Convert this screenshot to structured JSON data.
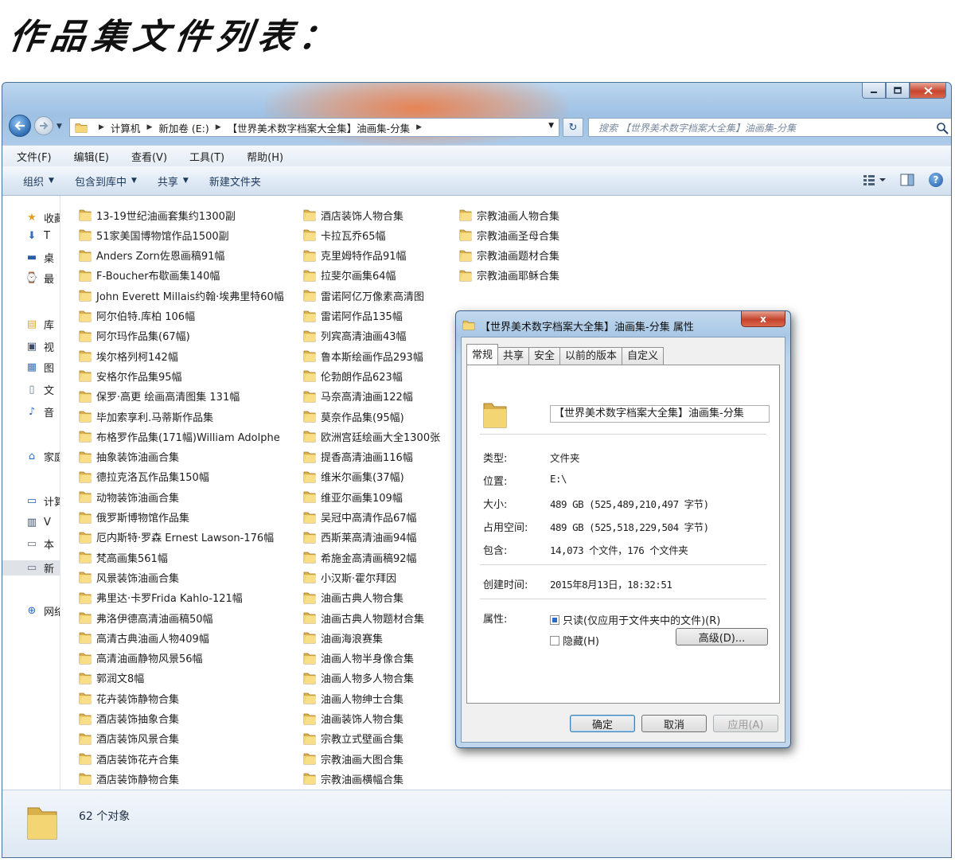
{
  "heading": "作品集文件列表：",
  "window": {
    "controls": {
      "minimize_icon": "minimize-icon",
      "maximize_icon": "maximize-icon",
      "close_icon": "close-icon"
    },
    "address": {
      "breadcrumbs": [
        "计算机",
        "新加卷 (E:)",
        "【世界美术数字档案大全集】油画集-分集"
      ]
    },
    "search": {
      "placeholder": "搜索 【世界美术数字档案大全集】油画集-分集"
    },
    "menu": [
      "文件(F)",
      "编辑(E)",
      "查看(V)",
      "工具(T)",
      "帮助(H)"
    ],
    "toolbar": [
      "组织",
      "包含到库中",
      "共享",
      "新建文件夹"
    ],
    "nav": [
      {
        "label": "收藏",
        "icon": "star-icon"
      },
      {
        "label": "T",
        "icon": "download-folder-icon"
      },
      {
        "label": "桌",
        "icon": "desktop-icon"
      },
      {
        "label": "最",
        "icon": "recent-places-icon"
      },
      {
        "label": "库",
        "icon": "library-icon"
      },
      {
        "label": "视",
        "icon": "video-icon"
      },
      {
        "label": "图",
        "icon": "pictures-icon"
      },
      {
        "label": "文",
        "icon": "documents-icon"
      },
      {
        "label": "音",
        "icon": "music-icon"
      },
      {
        "label": "家庭",
        "icon": "homegroup-icon"
      },
      {
        "label": "计算",
        "icon": "computer-icon"
      },
      {
        "label": "V",
        "icon": "drive-icon"
      },
      {
        "label": "本",
        "icon": "disk-icon"
      },
      {
        "label": "新",
        "icon": "disk-icon"
      },
      {
        "label": "网络",
        "icon": "network-icon"
      }
    ],
    "files": {
      "col1": [
        "13-19世纪油画套集约1300副",
        "51家美国博物馆作品1500副",
        "Anders Zorn佐恩画稿91幅",
        "F-Boucher布歇画集140幅",
        "John Everett Millais约翰·埃弗里特60幅",
        "阿尔伯特.库柏  106幅",
        "阿尔玛作品集(67幅)",
        "埃尔格列柯142幅",
        "安格尔作品集95幅",
        "保罗·高更 绘画高清图集 131幅",
        "毕加索享利.马蒂斯作品集",
        "布格罗作品集(171幅)William Adolphe",
        "抽象装饰油画合集",
        "德拉克洛瓦作品集150幅",
        "动物装饰油画合集",
        "俄罗斯博物馆作品集",
        "厄内斯特·罗森 Ernest Lawson-176幅",
        "梵高画集561幅",
        "风景装饰油画合集",
        "弗里达·卡罗Frida Kahlo-121幅",
        "弗洛伊德高清油画稿50幅",
        "高清古典油画人物409幅",
        "高清油画静物风景56幅",
        "郭润文8幅",
        "花卉装饰静物合集",
        "酒店装饰抽象合集",
        "酒店装饰风景合集",
        "酒店装饰花卉合集",
        "酒店装饰静物合集"
      ],
      "col2": [
        "酒店装饰人物合集",
        "卡拉瓦乔65幅",
        "克里姆特作品91幅",
        "拉斐尔画集64幅",
        "雷诺阿亿万像素高清图",
        "雷诺阿作品135幅",
        "列宾高清油画43幅",
        "鲁本斯绘画作品293幅",
        "伦勃朗作品623幅",
        "马奈高清油画122幅",
        "莫奈作品集(95幅)",
        "欧洲宫廷绘画大全1300张",
        "提香高清油画116幅",
        "维米尔画集(37幅)",
        "维亚尔画集109幅",
        "吴冠中高清作品67幅",
        "西斯莱高清油画94幅",
        "希施金高清画稿92幅",
        "小汉斯·霍尔拜因",
        "油画古典人物合集",
        "油画古典人物题材合集",
        "油画海浪赛集",
        "油画人物半身像合集",
        "油画人物多人物合集",
        "油画人物绅士合集",
        "油画装饰人物合集",
        "宗教立式壁画合集",
        "宗教油画大图合集",
        "宗教油画横幅合集"
      ],
      "col3": [
        "宗教油画人物合集",
        "宗教油画圣母合集",
        "宗教油画题材合集",
        "宗教油画耶稣合集"
      ]
    },
    "status": "62 个对象"
  },
  "dialog": {
    "title": "【世界美术数字档案大全集】油画集-分集 属性",
    "close_label": "x",
    "tabs": [
      "常规",
      "共享",
      "安全",
      "以前的版本",
      "自定义"
    ],
    "name": "【世界美术数字档案大全集】油画集-分集",
    "props": [
      {
        "label": "类型:",
        "value": "文件夹"
      },
      {
        "label": "位置:",
        "value": "E:\\"
      },
      {
        "label": "大小:",
        "value": "489 GB (525,489,210,497 字节)"
      },
      {
        "label": "占用空间:",
        "value": "489 GB (525,518,229,504 字节)"
      },
      {
        "label": "包含:",
        "value": "14,073 个文件，176 个文件夹"
      },
      {
        "label": "创建时间:",
        "value": "2015年8月13日，18:32:51"
      }
    ],
    "attributes_label": "属性:",
    "readonly_label": "只读(仅应用于文件夹中的文件)(R)",
    "hidden_label": "隐藏(H)",
    "advanced_label": "高级(D)...",
    "ok_label": "确定",
    "cancel_label": "取消",
    "apply_label": "应用(A)"
  }
}
